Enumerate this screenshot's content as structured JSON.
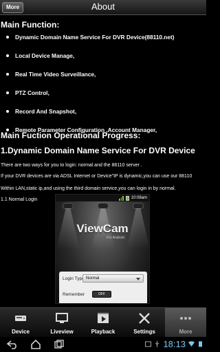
{
  "titlebar": {
    "back_label": "More",
    "title": "About"
  },
  "sections": {
    "main_function_heading": "Main Function:",
    "functions": [
      "Dynamic Domain Name Service For DVR Device(88110.net)",
      "Local Device Manage,",
      "Real Time Video Surveillance,",
      "PTZ Control,",
      "Record And Snapshot,",
      "Remote Parameter Configuration ,Account Manager,"
    ],
    "progress_heading": "Main Fuction Operational Progress:",
    "ddns_heading": "1.Dynamic Domain Name Service For DVR Device",
    "paragraphs": [
      "There are two ways for you to login: normal  and the 88110 server .",
      "If your DVR devices are via  ADSL  Internet or Device\"IP is dynamic,you can use our 88110",
      "Within LAN,static ip,and using the third domain service,you can login in by normal.",
      "1.1 Normal Login"
    ]
  },
  "phone_screenshot": {
    "status_time": "10:08am",
    "logo": "ViewCam",
    "logo_sub": "For Android",
    "login_type_label": "Login Type",
    "login_type_value": "Normal",
    "remember_label": "Remember",
    "remember_value": "OFF"
  },
  "tabbar": {
    "tabs": [
      {
        "label": "Device",
        "icon": "dvr-device-icon"
      },
      {
        "label": "Liveview",
        "icon": "monitor-icon"
      },
      {
        "label": "Playback",
        "icon": "film-play-icon"
      },
      {
        "label": "Settings",
        "icon": "tools-icon"
      },
      {
        "label": "More",
        "icon": "more-dots-icon"
      }
    ],
    "active": "More"
  },
  "system_bar": {
    "clock": "18:13",
    "icons": [
      "back-icon",
      "home-icon",
      "recent-apps-icon",
      "gallery-icon",
      "usb-icon",
      "wifi-icon",
      "battery-icon"
    ]
  },
  "colors": {
    "clock": "#7ac6ef",
    "background": "#000000",
    "active_tab": "#4a4a4a"
  }
}
